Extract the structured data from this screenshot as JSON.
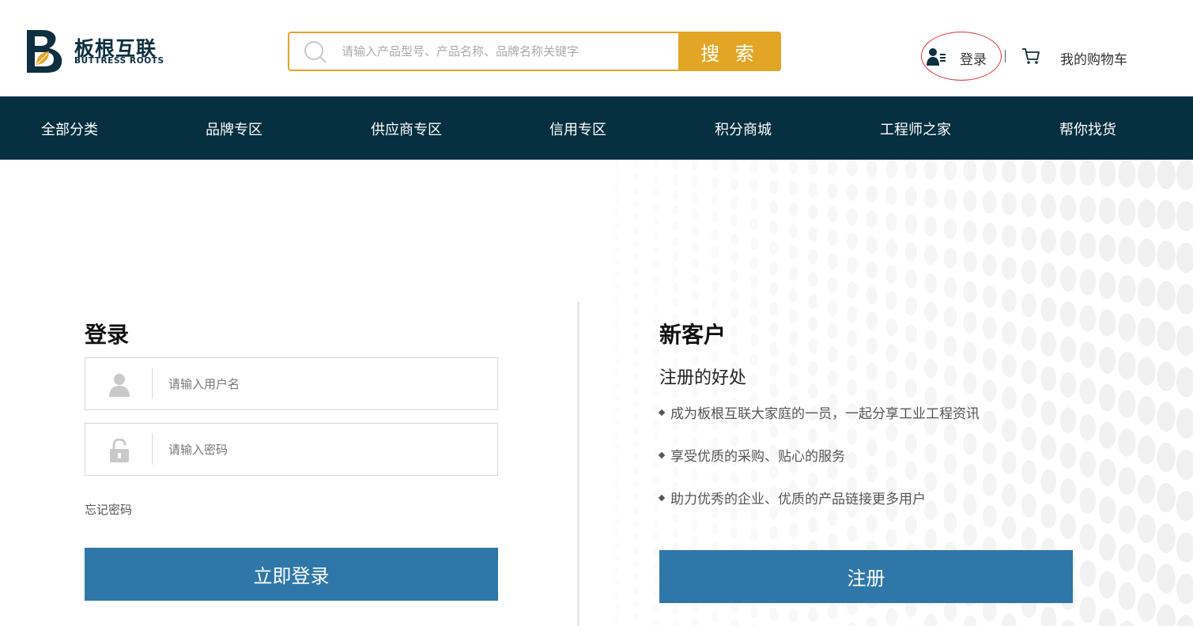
{
  "header": {
    "logo": {
      "cn": "板根互联",
      "en": "BUTTRESS ROOTS"
    },
    "search": {
      "placeholder": "请输入产品型号、产品名称、品牌名称关键字",
      "button_label": "搜 索"
    },
    "login_label": "登录",
    "cart_label": "我的购物车"
  },
  "nav": {
    "items": [
      "全部分类",
      "品牌专区",
      "供应商专区",
      "信用专区",
      "积分商城",
      "工程师之家",
      "帮你找货"
    ]
  },
  "login": {
    "title": "登录",
    "username_placeholder": "请输入用户名",
    "password_placeholder": "请输入密码",
    "forgot_label": "忘记密码",
    "submit_label": "立即登录"
  },
  "register": {
    "title": "新客户",
    "subtitle": "注册的好处",
    "benefits": [
      "成为板根互联大家庭的一员，一起分享工业工程资讯",
      "享受优质的采购、贴心的服务",
      "助力优秀的企业、优质的产品链接更多用户"
    ],
    "button_label": "注册"
  },
  "colors": {
    "brand_dark": "#062f40",
    "accent_gold": "#e3a526",
    "button_blue": "#2e77a8",
    "highlight_red": "#e0303a"
  }
}
